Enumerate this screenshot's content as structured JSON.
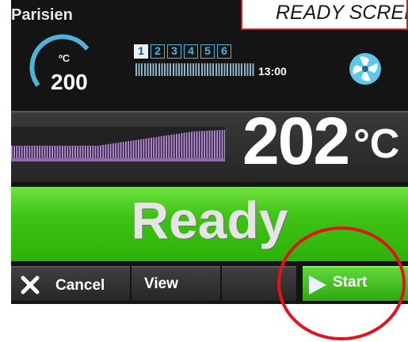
{
  "annotation": {
    "banner_text": "READY SCREEN"
  },
  "program": {
    "name": "Parisien"
  },
  "setpoint": {
    "unit": "ºC",
    "value": "200"
  },
  "steps": [
    {
      "label": "1",
      "active": true
    },
    {
      "label": "2",
      "active": false
    },
    {
      "label": "3",
      "active": false
    },
    {
      "label": "4",
      "active": false
    },
    {
      "label": "5",
      "active": false
    },
    {
      "label": "6",
      "active": false
    }
  ],
  "timer": {
    "time": "13:00"
  },
  "temperature": {
    "value": "202",
    "unit": "°C"
  },
  "status": {
    "text": "Ready"
  },
  "buttons": {
    "cancel": "Cancel",
    "view": "View",
    "start": "Start"
  },
  "icons": {
    "cancel": "close-icon",
    "start": "play-icon",
    "fan": "fan-icon"
  },
  "colors": {
    "status_green": "#3ec213",
    "accent_cyan": "#4fb2d6",
    "bar_purple": "#b98be0",
    "highlight_red": "#e0141b"
  }
}
